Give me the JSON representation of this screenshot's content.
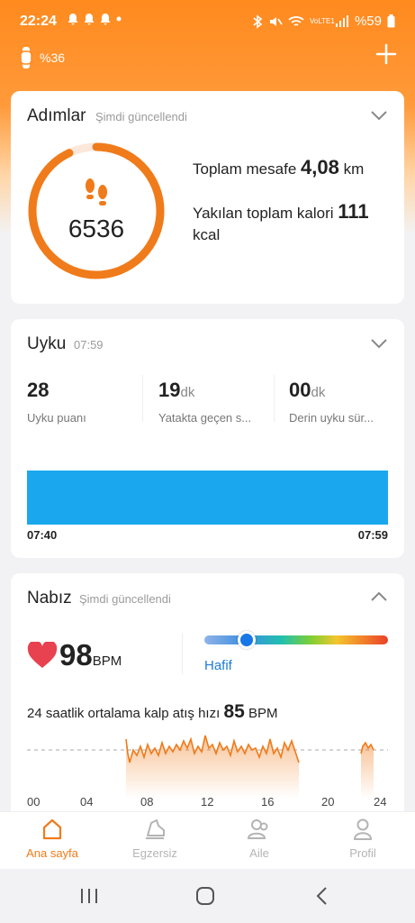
{
  "status": {
    "time": "22:24",
    "battery": "%59",
    "network": "VoLTE1"
  },
  "device": {
    "battery": "%36"
  },
  "steps": {
    "title": "Adımlar",
    "updated": "Şimdi güncellendi",
    "count": "6536",
    "progress_fraction": 0.93,
    "distance_label": "Toplam mesafe",
    "distance_value": "4,08",
    "distance_unit": "km",
    "calorie_label": "Yakılan toplam kalori",
    "calorie_value": "111",
    "calorie_unit": "kcal"
  },
  "sleep": {
    "title": "Uyku",
    "time": "07:59",
    "metrics": [
      {
        "value": "28",
        "unit": "",
        "label": "Uyku puanı"
      },
      {
        "value": "19",
        "unit": "dk",
        "label": "Yatakta geçen s..."
      },
      {
        "value": "00",
        "unit": "dk",
        "label": "Derin uyku sür..."
      }
    ],
    "start": "07:40",
    "end": "07:59"
  },
  "heart": {
    "title": "Nabız",
    "updated": "Şimdi güncellendi",
    "value": "98",
    "unit": "BPM",
    "zone": "Hafif",
    "avg_label": "24 saatlik ortalama kalp atış hızı",
    "avg_value": "85",
    "avg_unit": "BPM",
    "axis": [
      "00",
      "04",
      "08",
      "12",
      "16",
      "20",
      "24"
    ]
  },
  "nav": {
    "items": [
      {
        "label": "Ana sayfa",
        "icon": "home-icon",
        "active": true
      },
      {
        "label": "Egzersiz",
        "icon": "shoe-icon",
        "active": false
      },
      {
        "label": "Aile",
        "icon": "family-icon",
        "active": false
      },
      {
        "label": "Profil",
        "icon": "profile-icon",
        "active": false
      }
    ]
  },
  "colors": {
    "brand": "#f07b1a",
    "sleep_bar": "#1aa7ee",
    "zone_text": "#1e7cd8",
    "heart": "#e8414f"
  }
}
